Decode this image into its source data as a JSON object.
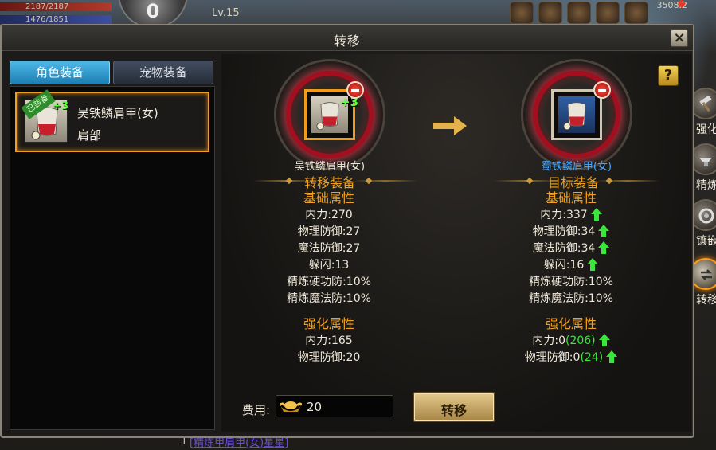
{
  "hud": {
    "hp_text": "2187/2187",
    "mp_text": "1476/1851",
    "vip_level": "0",
    "level": "Lv.15",
    "top_right_value": "3508.2"
  },
  "dialog": {
    "title": "转移",
    "close_label": "×",
    "help_label": "?"
  },
  "tabs": [
    {
      "label": "角色装备",
      "active": true
    },
    {
      "label": "宠物装备",
      "active": false
    }
  ],
  "equipment_list": [
    {
      "equipped_tag": "已装备",
      "enhance": "+3",
      "name": "吴铁鳞肩甲(女)",
      "slot": "肩部"
    }
  ],
  "source": {
    "enhance": "+3",
    "name": "吴铁鳞肩甲(女)",
    "section_title": "转移装备",
    "base_title": "基础属性",
    "base_stats": [
      {
        "label": "内力:",
        "value": "270"
      },
      {
        "label": "物理防御:",
        "value": "27"
      },
      {
        "label": "魔法防御:",
        "value": "27"
      },
      {
        "label": "躲闪:",
        "value": "13"
      },
      {
        "label": "精炼硬功防:",
        "value": "10%"
      },
      {
        "label": "精炼魔法防:",
        "value": "10%"
      }
    ],
    "enhance_title": "强化属性",
    "enhance_stats": [
      {
        "label": "内力:",
        "value": "165"
      },
      {
        "label": "物理防御:",
        "value": "20"
      }
    ]
  },
  "target": {
    "name": "蜀铁鳞肩甲(女)",
    "section_title": "目标装备",
    "base_title": "基础属性",
    "base_stats": [
      {
        "label": "内力:",
        "value": "337",
        "up": true
      },
      {
        "label": "物理防御:",
        "value": "34",
        "up": true
      },
      {
        "label": "魔法防御:",
        "value": "34",
        "up": true
      },
      {
        "label": "躲闪:",
        "value": "16",
        "up": true
      },
      {
        "label": "精炼硬功防:",
        "value": "10%",
        "up": false
      },
      {
        "label": "精炼魔法防:",
        "value": "10%",
        "up": false
      }
    ],
    "enhance_title": "强化属性",
    "enhance_stats": [
      {
        "label": "内力:",
        "value": "0",
        "bonus": "(206)",
        "up": true
      },
      {
        "label": "物理防御:",
        "value": "0",
        "bonus": "(24)",
        "up": true
      }
    ]
  },
  "fee": {
    "label": "费用:",
    "value": "20",
    "currency_icon": "gold-ingot-icon"
  },
  "transfer_button": "转移",
  "side_tabs": [
    {
      "label": "强化",
      "icon": "hammer-icon",
      "active": false
    },
    {
      "label": "精炼",
      "icon": "anvil-icon",
      "active": false
    },
    {
      "label": "镶嵌",
      "icon": "gem-socket-icon",
      "active": false
    },
    {
      "label": "转移",
      "icon": "transfer-icon",
      "active": true
    }
  ],
  "chat": {
    "prefix": "]",
    "link_text": "[精炼甲肩甲(女)星星]"
  },
  "colors": {
    "accent_orange": "#f0a020",
    "target_blue": "#47a8ff",
    "stat_up_green": "#39e63a",
    "tab_active_blue": "#1d7fb3"
  }
}
